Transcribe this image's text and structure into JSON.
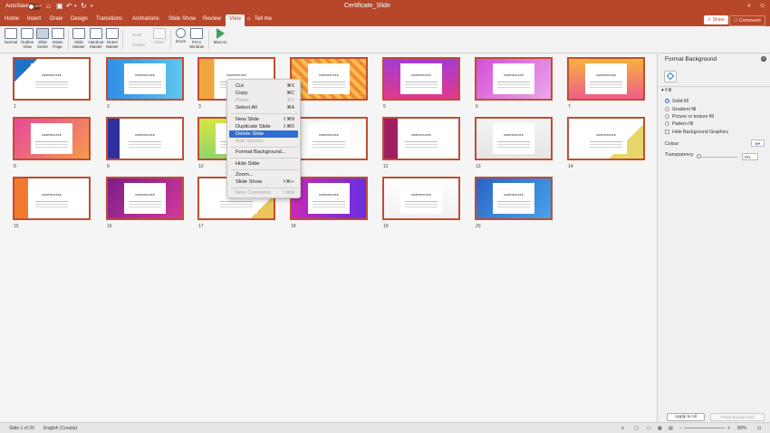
{
  "titlebar": {
    "autosave_label": "AutoSave",
    "autosave_state": "OFF",
    "document_title": "Certificate_Slide"
  },
  "menu_tabs": [
    "Home",
    "Insert",
    "Draw",
    "Design",
    "Transitions",
    "Animations",
    "Slide Show",
    "Review",
    "View",
    "Tell me"
  ],
  "active_tab": "View",
  "share_label": "Share",
  "comments_label": "Comments",
  "ribbon": {
    "normal": "Normal",
    "outline_view": "Outline View",
    "slide_sorter": "Slide Sorter",
    "notes_page": "Notes Page",
    "slide_master": "Slide Master",
    "handout_master": "Handout Master",
    "notes_master": "Notes Master",
    "ruler": "Ruler",
    "guides": "Guides",
    "notes": "Notes",
    "zoom": "Zoom",
    "fit_to_window": "Fit to Window",
    "macros": "Macros"
  },
  "slides": [
    {
      "num": "1",
      "title": "CERTIFICATE"
    },
    {
      "num": "2",
      "title": "CERTIFICATE"
    },
    {
      "num": "3",
      "title": "CERTIFICATE"
    },
    {
      "num": "4",
      "title": "CERTIFICATE"
    },
    {
      "num": "5",
      "title": "CERTIFICATE"
    },
    {
      "num": "6",
      "title": "CERTIFICATE"
    },
    {
      "num": "7",
      "title": "CERTIFICATE"
    },
    {
      "num": "8",
      "title": "CERTIFICATE"
    },
    {
      "num": "9",
      "title": "CERTIFICATE"
    },
    {
      "num": "10",
      "title": "CERTIFICATE"
    },
    {
      "num": "11",
      "title": "CERTIFICATE"
    },
    {
      "num": "12",
      "title": "CERTIFICATE"
    },
    {
      "num": "13",
      "title": "CERTIFICATE"
    },
    {
      "num": "14",
      "title": "CERTIFICATE"
    },
    {
      "num": "15",
      "title": "CERTIFICATE"
    },
    {
      "num": "16",
      "title": "CERTIFICATE"
    },
    {
      "num": "17",
      "title": "CERTIFICATE"
    },
    {
      "num": "18",
      "title": "CERTIFICATE"
    },
    {
      "num": "19",
      "title": "CERTIFICATE"
    },
    {
      "num": "20",
      "title": "CERTIFICATE"
    }
  ],
  "context_menu": {
    "cut": {
      "label": "Cut",
      "shortcut": "⌘X"
    },
    "copy": {
      "label": "Copy",
      "shortcut": "⌘C"
    },
    "paste": {
      "label": "Paste",
      "shortcut": "⌘V"
    },
    "select_all": {
      "label": "Select All",
      "shortcut": "⌘A"
    },
    "new_slide": {
      "label": "New Slide",
      "shortcut": "⇧⌘N"
    },
    "duplicate_slide": {
      "label": "Duplicate Slide",
      "shortcut": "⇧⌘D"
    },
    "delete_slide": {
      "label": "Delete Slide"
    },
    "add_section": {
      "label": "Add Section"
    },
    "format_background": {
      "label": "Format Background..."
    },
    "hide_slide": {
      "label": "Hide Slide"
    },
    "zoom": {
      "label": "Zoom..."
    },
    "slide_show": {
      "label": "Slide Show",
      "shortcut": "⇧⌘↩"
    },
    "new_comment": {
      "label": "New Comment",
      "shortcut": "⇧⌘M"
    }
  },
  "format_pane": {
    "title": "Format Background",
    "fill_section": "Fill",
    "options": [
      "Solid fill",
      "Gradient fill",
      "Picture or texture fill",
      "Pattern fill"
    ],
    "hide_graphics": "Hide Background Graphics",
    "colour_label": "Colour",
    "transparency_label": "Transparency",
    "transparency_value": "0%",
    "apply_all": "Apply to All",
    "reset": "Reset Background"
  },
  "statusbar": {
    "slide_info": "Slide 1 of 20",
    "language": "English (Croatia)",
    "zoom": "80%"
  },
  "colors": {
    "accent": "#b7472a",
    "selection": "#2f6ed0",
    "slide_border": "#c14d32"
  }
}
